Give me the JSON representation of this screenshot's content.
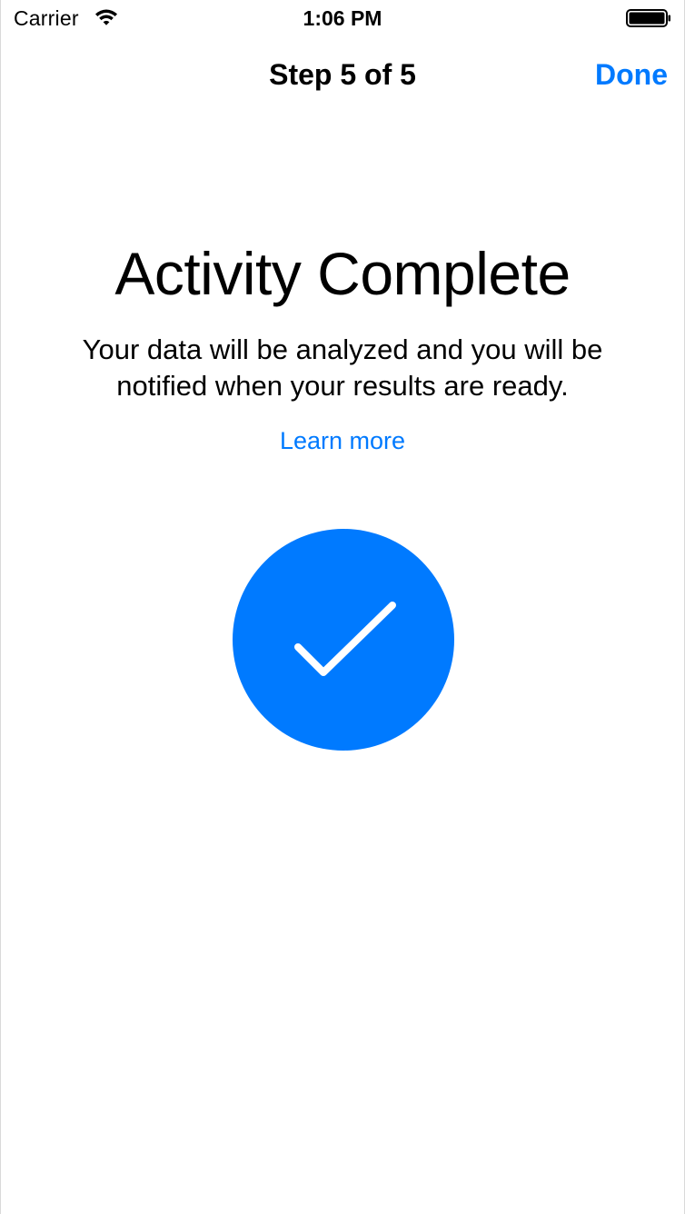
{
  "status_bar": {
    "carrier": "Carrier",
    "time": "1:06 PM",
    "icons": [
      "wifi-icon",
      "battery-icon"
    ]
  },
  "nav": {
    "title": "Step 5 of 5",
    "done_label": "Done"
  },
  "content": {
    "headline": "Activity Complete",
    "body": "Your data will be analyzed and you will be notified when your results are ready.",
    "learn_more": "Learn more",
    "completion_icon": "checkmark-circle-icon"
  },
  "colors": {
    "accent": "#007aff",
    "text": "#000000",
    "background": "#ffffff"
  }
}
